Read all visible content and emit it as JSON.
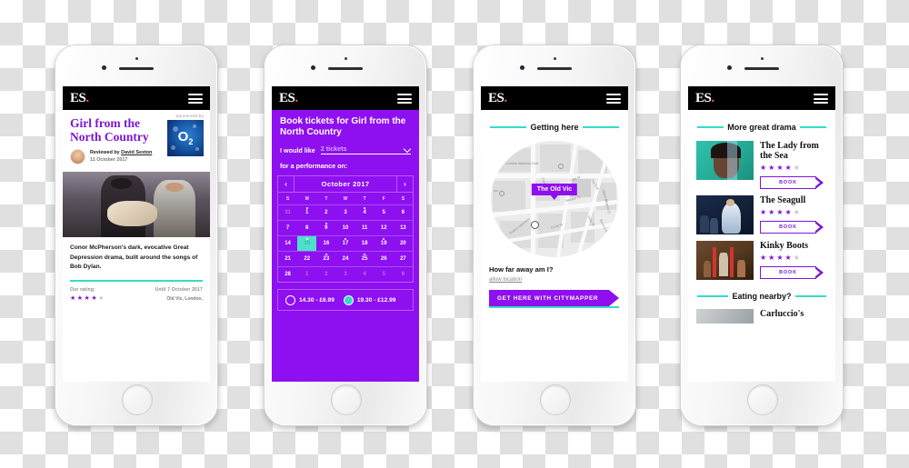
{
  "brand": {
    "logo": "ES",
    "logo_dot": ".",
    "menu": "menu-icon"
  },
  "colors": {
    "purple": "#8e0ff0",
    "purple_text": "#7b16d8",
    "teal": "#35dcc7",
    "teal_sel": "#4fe0cc",
    "black": "#000000",
    "orange": "#f0642a"
  },
  "phone1": {
    "sponsored_label": "Sponsored by",
    "sponsor_logo": "O2",
    "title": "Girl from the North Country",
    "reviewed_prefix": "Reviewed by",
    "reviewer": "David Sexton",
    "date": "11 October 2017",
    "description": "Conor McPherson's dark, evocative Great Depression drama, built around the songs of Bob Dylan.",
    "rating_label": "Our rating:",
    "rating_stars": 4,
    "rating_max": 5,
    "until": "Until 7 October 2017",
    "venue": "Old Vic, London."
  },
  "phone2": {
    "heading": "Book tickets for Girl from the North Country",
    "qty_label": "I would like",
    "qty_value": "2 tickets",
    "qty_caret": "chevron-down-icon",
    "perf_label": "for a performance on:",
    "calendar": {
      "prev": "‹",
      "next": "›",
      "month": "October 2017",
      "dow": [
        "S",
        "M",
        "T",
        "W",
        "T",
        "F",
        "S"
      ],
      "weeks": [
        [
          {
            "d": "31",
            "mute": true
          },
          {
            "d": "1",
            "evt": true
          },
          {
            "d": "2"
          },
          {
            "d": "3"
          },
          {
            "d": "4",
            "evt": true
          },
          {
            "d": "5"
          },
          {
            "d": "6"
          }
        ],
        [
          {
            "d": "7"
          },
          {
            "d": "8"
          },
          {
            "d": "9",
            "evt": true
          },
          {
            "d": "10"
          },
          {
            "d": "11"
          },
          {
            "d": "12"
          },
          {
            "d": "13"
          }
        ],
        [
          {
            "d": "14"
          },
          {
            "d": "15",
            "sel": true,
            "evt": true
          },
          {
            "d": "16"
          },
          {
            "d": "17",
            "evt": true
          },
          {
            "d": "18"
          },
          {
            "d": "19",
            "evt": true
          },
          {
            "d": "20"
          }
        ],
        [
          {
            "d": "21"
          },
          {
            "d": "22"
          },
          {
            "d": "23",
            "evt": true
          },
          {
            "d": "24"
          },
          {
            "d": "25",
            "evt": true
          },
          {
            "d": "26"
          },
          {
            "d": "27"
          }
        ],
        [
          {
            "d": "28"
          },
          {
            "d": "1",
            "mute": true
          },
          {
            "d": "2",
            "mute": true
          },
          {
            "d": "3",
            "mute": true
          },
          {
            "d": "4",
            "mute": true
          },
          {
            "d": "5",
            "mute": true
          },
          {
            "d": "6",
            "mute": true
          }
        ]
      ]
    },
    "times": [
      {
        "label": "14.30 - £6.99",
        "selected": false
      },
      {
        "label": "19.30 - £12.99",
        "selected": true
      }
    ]
  },
  "phone3": {
    "section_title": "Getting here",
    "map_labels": [
      "London Waterloo East",
      "Station Approach",
      "Cornwall Rd",
      "Cons St",
      "The Cut",
      "Ufford St",
      "Gray St",
      "Baron's Pl",
      "Coral St",
      "Webber St",
      "Chaplin Cl",
      "loo"
    ],
    "pin_label": "The Old Vic",
    "question": "How far away am I?",
    "link": "allow location",
    "cta": "GET HERE WITH CITYMAPPER"
  },
  "phone4": {
    "section_title": "More great drama",
    "shows": [
      {
        "title": "The Lady from the Sea",
        "stars": 4,
        "max": 5,
        "book": "BOOK",
        "thumb": "lady-from-the-sea-thumb"
      },
      {
        "title": "The Seagull",
        "stars": 4,
        "max": 5,
        "book": "BOOK",
        "thumb": "seagull-thumb"
      },
      {
        "title": "Kinky Boots",
        "stars": 4,
        "max": 5,
        "book": "BOOK",
        "thumb": "kinky-boots-thumb"
      }
    ],
    "eating_title": "Eating nearby?",
    "eating_first": "Carluccio's"
  }
}
